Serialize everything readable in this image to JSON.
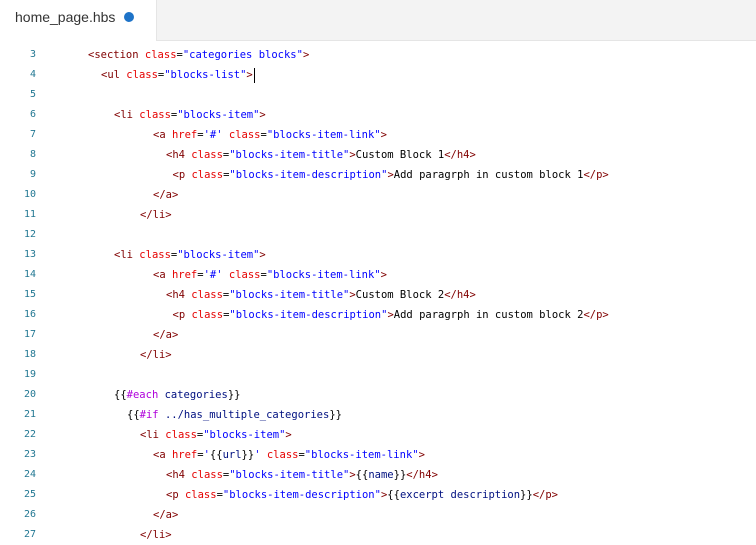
{
  "tab": {
    "title": "home_page.hbs",
    "unsaved": true
  },
  "lines": [
    {
      "n": "3",
      "indent": 0,
      "t": [
        [
          "tag",
          "<section "
        ],
        [
          "attr",
          "class"
        ],
        [
          "txt",
          "="
        ],
        [
          "str",
          "\"categories blocks\""
        ],
        [
          "tag",
          ">"
        ]
      ]
    },
    {
      "n": "4",
      "indent": 1,
      "cursor": true,
      "t": [
        [
          "tag",
          "<ul "
        ],
        [
          "attr",
          "class"
        ],
        [
          "txt",
          "="
        ],
        [
          "str",
          "\"blocks-list\""
        ],
        [
          "tag",
          ">"
        ]
      ]
    },
    {
      "n": "5",
      "indent": 0,
      "t": []
    },
    {
      "n": "6",
      "indent": 2,
      "t": [
        [
          "tag",
          "<li "
        ],
        [
          "attr",
          "class"
        ],
        [
          "txt",
          "="
        ],
        [
          "str",
          "\"blocks-item\""
        ],
        [
          "tag",
          ">"
        ]
      ]
    },
    {
      "n": "7",
      "indent": 5,
      "t": [
        [
          "tag",
          "<a "
        ],
        [
          "attr",
          "href"
        ],
        [
          "txt",
          "="
        ],
        [
          "str",
          "'#'"
        ],
        [
          "txt",
          " "
        ],
        [
          "attr",
          "class"
        ],
        [
          "txt",
          "="
        ],
        [
          "str",
          "\"blocks-item-link\""
        ],
        [
          "tag",
          ">"
        ]
      ]
    },
    {
      "n": "8",
      "indent": 6,
      "t": [
        [
          "tag",
          "<h4 "
        ],
        [
          "attr",
          "class"
        ],
        [
          "txt",
          "="
        ],
        [
          "str",
          "\"blocks-item-title\""
        ],
        [
          "tag",
          ">"
        ],
        [
          "txt",
          "Custom Block 1"
        ],
        [
          "tag",
          "</h4>"
        ]
      ]
    },
    {
      "n": "9",
      "indent": 6.5,
      "t": [
        [
          "tag",
          "<p "
        ],
        [
          "attr",
          "class"
        ],
        [
          "txt",
          "="
        ],
        [
          "str",
          "\"blocks-item-description\""
        ],
        [
          "tag",
          ">"
        ],
        [
          "txt",
          "Add paragrph in custom block 1"
        ],
        [
          "tag",
          "</p>"
        ]
      ]
    },
    {
      "n": "10",
      "indent": 5,
      "t": [
        [
          "tag",
          "</a>"
        ]
      ]
    },
    {
      "n": "11",
      "indent": 4,
      "t": [
        [
          "tag",
          "</li>"
        ]
      ]
    },
    {
      "n": "12",
      "indent": 0,
      "t": []
    },
    {
      "n": "13",
      "indent": 2,
      "t": [
        [
          "tag",
          "<li "
        ],
        [
          "attr",
          "class"
        ],
        [
          "txt",
          "="
        ],
        [
          "str",
          "\"blocks-item\""
        ],
        [
          "tag",
          ">"
        ]
      ]
    },
    {
      "n": "14",
      "indent": 5,
      "t": [
        [
          "tag",
          "<a "
        ],
        [
          "attr",
          "href"
        ],
        [
          "txt",
          "="
        ],
        [
          "str",
          "'#'"
        ],
        [
          "txt",
          " "
        ],
        [
          "attr",
          "class"
        ],
        [
          "txt",
          "="
        ],
        [
          "str",
          "\"blocks-item-link\""
        ],
        [
          "tag",
          ">"
        ]
      ]
    },
    {
      "n": "15",
      "indent": 6,
      "t": [
        [
          "tag",
          "<h4 "
        ],
        [
          "attr",
          "class"
        ],
        [
          "txt",
          "="
        ],
        [
          "str",
          "\"blocks-item-title\""
        ],
        [
          "tag",
          ">"
        ],
        [
          "txt",
          "Custom Block 2"
        ],
        [
          "tag",
          "</h4>"
        ]
      ]
    },
    {
      "n": "16",
      "indent": 6.5,
      "t": [
        [
          "tag",
          "<p "
        ],
        [
          "attr",
          "class"
        ],
        [
          "txt",
          "="
        ],
        [
          "str",
          "\"blocks-item-description\""
        ],
        [
          "tag",
          ">"
        ],
        [
          "txt",
          "Add paragrph in custom block 2"
        ],
        [
          "tag",
          "</p>"
        ]
      ]
    },
    {
      "n": "17",
      "indent": 5,
      "t": [
        [
          "tag",
          "</a>"
        ]
      ]
    },
    {
      "n": "18",
      "indent": 4,
      "t": [
        [
          "tag",
          "</li>"
        ]
      ]
    },
    {
      "n": "19",
      "indent": 0,
      "t": []
    },
    {
      "n": "20",
      "indent": 2,
      "t": [
        [
          "txt",
          "{{"
        ],
        [
          "kw",
          "#each"
        ],
        [
          "txt",
          " "
        ],
        [
          "hbs",
          "categories"
        ],
        [
          "txt",
          "}}"
        ]
      ]
    },
    {
      "n": "21",
      "indent": 3,
      "t": [
        [
          "txt",
          "{{"
        ],
        [
          "kw",
          "#if"
        ],
        [
          "txt",
          " "
        ],
        [
          "hbs",
          "../has_multiple_categories"
        ],
        [
          "txt",
          "}}"
        ]
      ]
    },
    {
      "n": "22",
      "indent": 4,
      "t": [
        [
          "tag",
          "<li "
        ],
        [
          "attr",
          "class"
        ],
        [
          "txt",
          "="
        ],
        [
          "str",
          "\"blocks-item\""
        ],
        [
          "tag",
          ">"
        ]
      ]
    },
    {
      "n": "23",
      "indent": 5,
      "t": [
        [
          "tag",
          "<a "
        ],
        [
          "attr",
          "href"
        ],
        [
          "txt",
          "="
        ],
        [
          "str",
          "'"
        ],
        [
          "txt",
          "{{"
        ],
        [
          "hbs",
          "url"
        ],
        [
          "txt",
          "}}"
        ],
        [
          "str",
          "'"
        ],
        [
          "txt",
          " "
        ],
        [
          "attr",
          "class"
        ],
        [
          "txt",
          "="
        ],
        [
          "str",
          "\"blocks-item-link\""
        ],
        [
          "tag",
          ">"
        ]
      ]
    },
    {
      "n": "24",
      "indent": 6,
      "t": [
        [
          "tag",
          "<h4 "
        ],
        [
          "attr",
          "class"
        ],
        [
          "txt",
          "="
        ],
        [
          "str",
          "\"blocks-item-title\""
        ],
        [
          "tag",
          ">"
        ],
        [
          "txt",
          "{{"
        ],
        [
          "hbs",
          "name"
        ],
        [
          "txt",
          "}}"
        ],
        [
          "tag",
          "</h4>"
        ]
      ]
    },
    {
      "n": "25",
      "indent": 6,
      "t": [
        [
          "tag",
          "<p "
        ],
        [
          "attr",
          "class"
        ],
        [
          "txt",
          "="
        ],
        [
          "str",
          "\"blocks-item-description\""
        ],
        [
          "tag",
          ">"
        ],
        [
          "txt",
          "{{"
        ],
        [
          "hbs",
          "excerpt description"
        ],
        [
          "txt",
          "}}"
        ],
        [
          "tag",
          "</p>"
        ]
      ]
    },
    {
      "n": "26",
      "indent": 5,
      "t": [
        [
          "tag",
          "</a>"
        ]
      ]
    },
    {
      "n": "27",
      "indent": 4,
      "t": [
        [
          "tag",
          "</li>"
        ]
      ]
    }
  ]
}
